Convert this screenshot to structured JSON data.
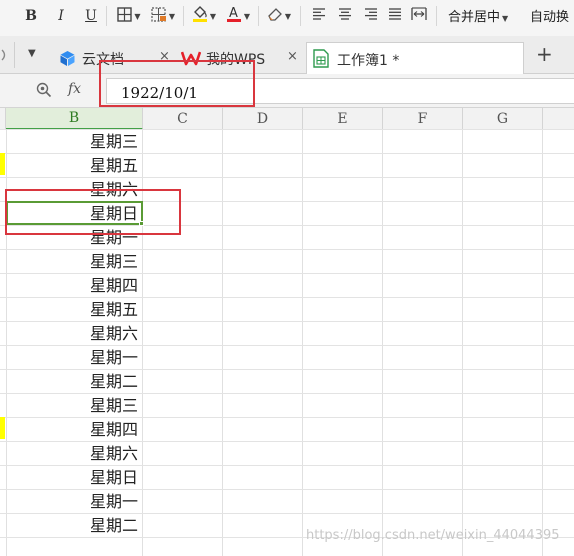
{
  "toolbar": {
    "bold": "B",
    "italic": "I",
    "underline": "U",
    "merge_center": "合并居中",
    "auto_wrap": "自动换"
  },
  "tabs": [
    {
      "label": "云文档"
    },
    {
      "label": "我的WPS"
    },
    {
      "label": "工作簿1 *"
    }
  ],
  "new_tab": "+",
  "tab_close": "×",
  "formula_bar": {
    "fx": "fx",
    "value": "1922/10/1"
  },
  "columns": [
    "B",
    "C",
    "D",
    "E",
    "F",
    "G"
  ],
  "cells_b": [
    "星期三",
    "星期五",
    "星期六",
    "星期日",
    "星期一",
    "星期三",
    "星期四",
    "星期五",
    "星期六",
    "星期一",
    "星期二",
    "星期三",
    "星期四",
    "星期六",
    "星期日",
    "星期一",
    "星期二"
  ],
  "watermark": "https://blog.csdn.net/weixin_44044395",
  "colors": {
    "accent_green": "#5a9b35",
    "highlight_red": "#d9363e",
    "row_marker_yellow": "#ffff00"
  }
}
